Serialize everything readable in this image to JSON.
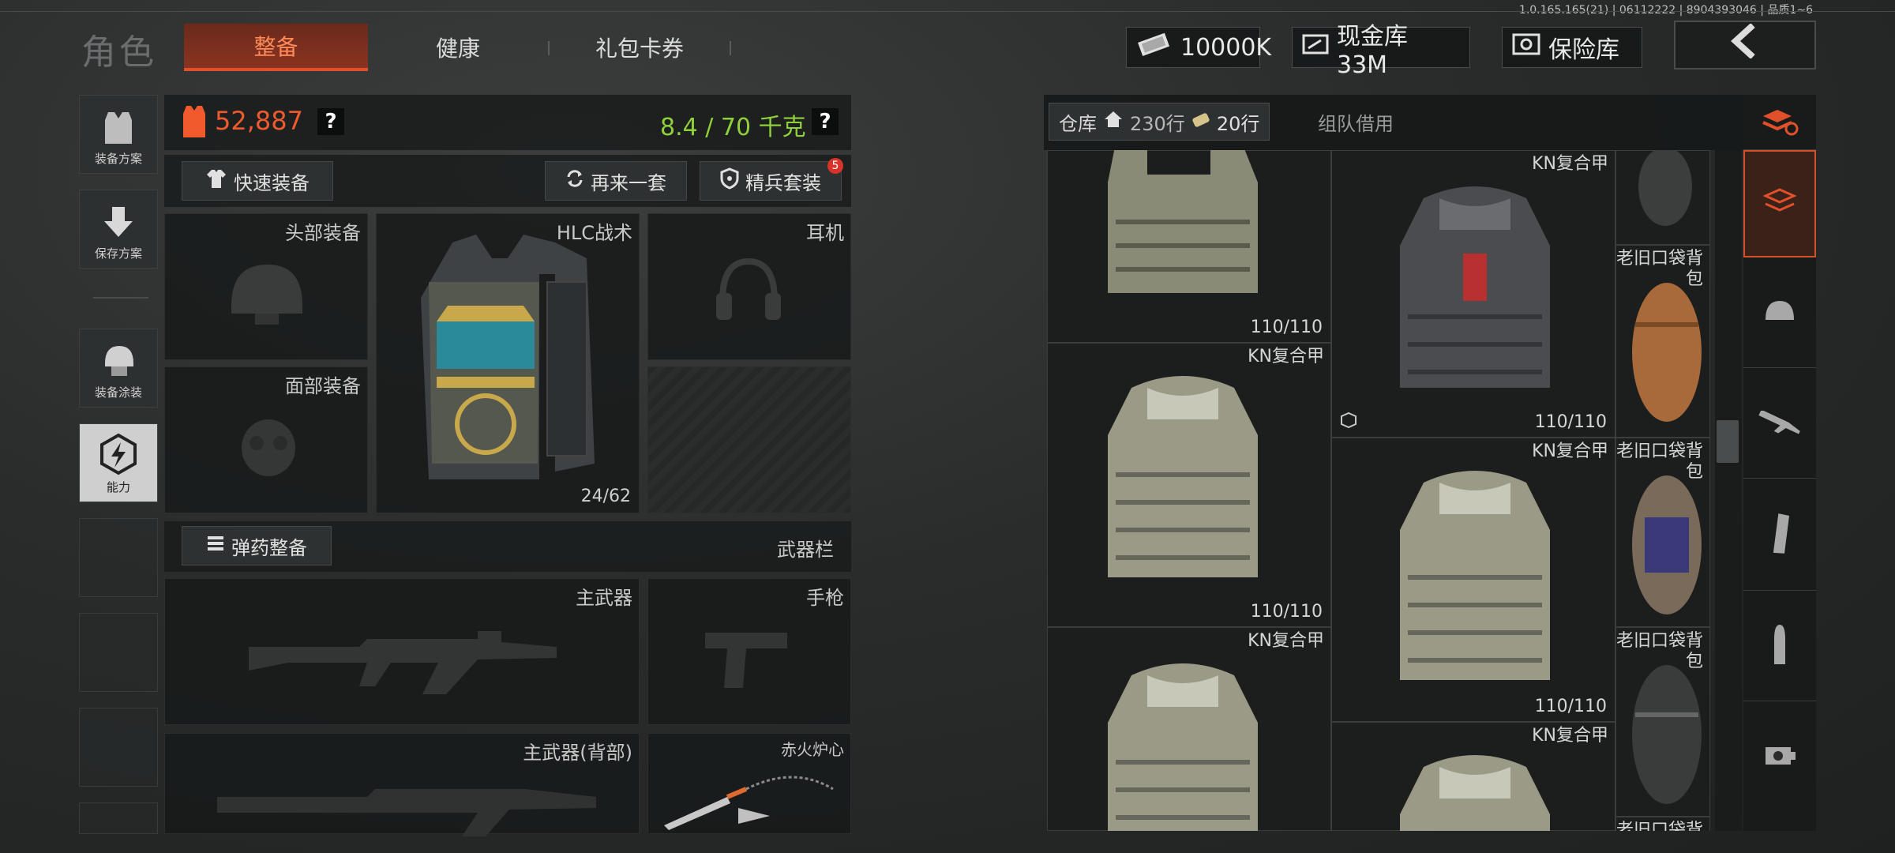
{
  "version": "1.0.165.165(21) | 06112222 | 8904393046 | 品质1~6",
  "header": {
    "role_title": "角色",
    "tabs": [
      {
        "label": "整备",
        "active": true
      },
      {
        "label": "健康",
        "active": false
      },
      {
        "label": "礼包卡券",
        "active": false
      }
    ],
    "currency_amount": "10000K",
    "cash_vault": "现金库 33M",
    "safe_vault": "保险库"
  },
  "sidebar": {
    "items": [
      {
        "label": "装备方案",
        "icon": "vest-icon"
      },
      {
        "label": "保存方案",
        "icon": "download-icon"
      },
      {
        "label": "装备涂装",
        "icon": "helmet-paint-icon"
      },
      {
        "label": "能力",
        "icon": "lightning-hex-icon",
        "active": true
      }
    ]
  },
  "equipment": {
    "value": "52,887",
    "weight": "8.4 / 70 千克",
    "quick_equip": "快速装备",
    "another_set": "再来一套",
    "elite_set": "精兵套装",
    "elite_badge": "5",
    "slots": {
      "head": "头部装备",
      "armor": "HLC战术",
      "armor_count": "24/62",
      "ear": "耳机",
      "face": "面部装备"
    },
    "ammo_btn": "弹药整备",
    "weapon_bar": "武器栏",
    "primary": "主武器",
    "pistol": "手枪",
    "primary_back": "主武器(背部)",
    "melee": "赤火炉心"
  },
  "warehouse": {
    "tab_label": "仓库",
    "rows_a": "230行",
    "rows_b": "20行",
    "team_borrow": "组队借用",
    "items": [
      {
        "name": "",
        "durability": "110/110"
      },
      {
        "name": "KN复合甲",
        "durability": "110/110"
      },
      {
        "name": "KN复合甲",
        "durability": "110/110"
      },
      {
        "name": "KN复合甲",
        "durability": "110/110"
      },
      {
        "name": "KN复合甲",
        "durability": "110/110"
      },
      {
        "name": "KN复合甲",
        "durability": ""
      },
      {
        "name": "KN复合甲",
        "durability": ""
      }
    ],
    "bag_labels": [
      "老旧口袋背包",
      "老旧口袋背包",
      "老旧口袋背包",
      "老旧口袋背"
    ]
  },
  "colors": {
    "accent_orange": "#e0502a",
    "value_orange": "#f05a2c",
    "weight_green": "#8fd13a"
  }
}
